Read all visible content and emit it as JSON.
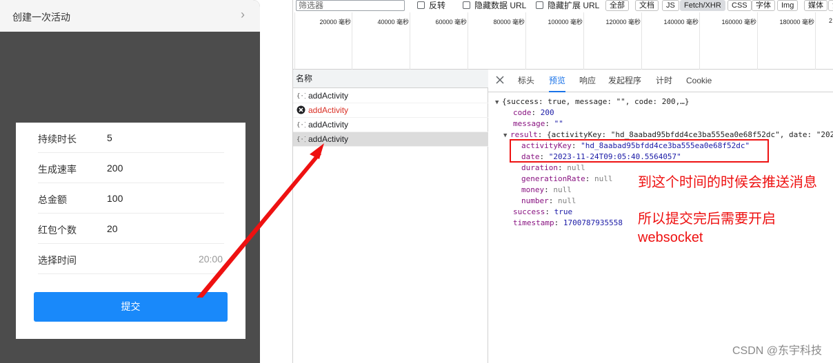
{
  "phone": {
    "title": "创建一次活动",
    "back_glyph": "›",
    "form": [
      {
        "label": "持续时长",
        "value": "5"
      },
      {
        "label": "生成速率",
        "value": "200"
      },
      {
        "label": "总金额",
        "value": "100"
      },
      {
        "label": "红包个数",
        "value": "20"
      },
      {
        "label": "选择时间",
        "value": "20:00"
      }
    ],
    "submit_label": "提交",
    "accent": "#1989fa"
  },
  "devtools": {
    "filter_placeholder": "筛选器",
    "checkboxes": [
      "反转",
      "隐藏数据 URL",
      "隐藏扩展 URL"
    ],
    "type_filters": [
      "全部",
      "文档",
      "JS",
      "Fetch/XHR",
      "CSS",
      "字体",
      "Img",
      "媒体",
      "清"
    ],
    "active_filter": "Fetch/XHR",
    "timeline_ticks": [
      "20000 毫秒",
      "40000 毫秒",
      "60000 毫秒",
      "80000 毫秒",
      "100000 毫秒",
      "120000 毫秒",
      "140000 毫秒",
      "160000 毫秒",
      "180000 毫秒",
      "2"
    ],
    "name_header": "名称",
    "requests": [
      {
        "name": "addActivity",
        "status": "ok"
      },
      {
        "name": "addActivity",
        "status": "error"
      },
      {
        "name": "addActivity",
        "status": "ok"
      },
      {
        "name": "addActivity",
        "status": "ok",
        "selected": true
      }
    ],
    "tabs": [
      "标头",
      "预览",
      "响应",
      "发起程序",
      "计时",
      "Cookie"
    ],
    "active_tab": "预览",
    "preview": {
      "summary": "{success: true, message: \"\", code: 200,…}",
      "code_key": "code",
      "code_val": "200",
      "message_key": "message",
      "message_val": "\"\"",
      "result_key": "result",
      "result_summary": "{activityKey: \"hd_8aabad95bfdd4ce3ba555ea0e68f52dc\", date: \"202",
      "activityKey_key": "activityKey",
      "activityKey_val": "\"hd_8aabad95bfdd4ce3ba555ea0e68f52dc\"",
      "date_key": "date",
      "date_val": "\"2023-11-24T09:05:40.5564057\"",
      "duration_key": "duration",
      "duration_val": "null",
      "generationRate_key": "generationRate",
      "generationRate_val": "null",
      "money_key": "money",
      "money_val": "null",
      "number_key": "number",
      "number_val": "null",
      "success_key": "success",
      "success_val": "true",
      "timestamp_key": "timestamp",
      "timestamp_val": "1700787935558"
    }
  },
  "annotations": {
    "line1": "到这个时间的时候会推送消息",
    "line2a": "所以提交完后需要开启",
    "line2b": "websocket",
    "color": "#ee1111"
  },
  "watermark": "CSDN @东宇科技"
}
